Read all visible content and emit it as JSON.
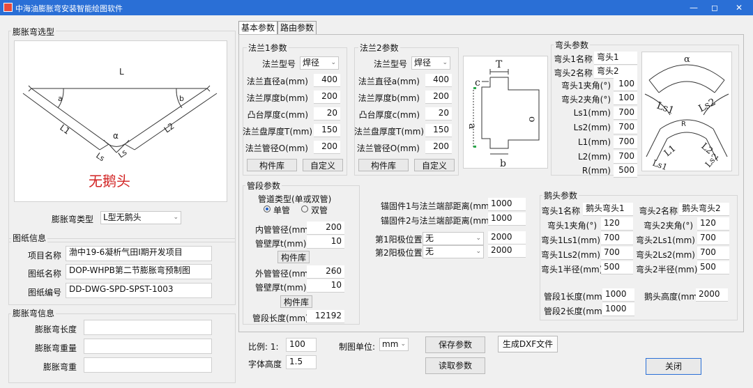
{
  "window": {
    "title": "中海油膨胀弯安装智能绘图软件"
  },
  "left": {
    "select_group": "膨胀弯选型",
    "diagram": {
      "L": "L",
      "a1": "a",
      "a2": "b",
      "L1": "L1",
      "L2": "L2",
      "alpha": "α",
      "Ls1": "Ls",
      "Ls2": "Ls",
      "caption": "无鹅头"
    },
    "type_label": "膨胀弯类型",
    "type_value": "L型无鹅头",
    "drawing_group": "图纸信息",
    "project_label": "项目名称",
    "project_value": "渤中19-6凝析气田Ⅰ期开发项目",
    "drawing_name_label": "图纸名称",
    "drawing_name_value": "DOP-WHPB第二节膨胀弯预制图",
    "drawing_no_label": "图纸编号",
    "drawing_no_value": "DD-DWG-SPD-SPST-1003",
    "info_group": "膨胀弯信息",
    "len_label": "膨胀弯长度",
    "weight_label": "膨胀弯重量",
    "weight2_label": "膨胀弯重"
  },
  "tabs": [
    "基本参数",
    "路由参数"
  ],
  "flange1": {
    "title": "法兰1参数",
    "type_label": "法兰型号",
    "type_value": "焊径",
    "rows": [
      {
        "label": "法兰直径a(mm)",
        "value": "400"
      },
      {
        "label": "法兰厚度b(mm)",
        "value": "200"
      },
      {
        "label": "凸台厚度c(mm)",
        "value": "20"
      },
      {
        "label": "法兰盘厚度T(mm)",
        "value": "150"
      },
      {
        "label": "法兰管径O(mm)",
        "value": "200"
      }
    ],
    "lib_btn": "构件库",
    "custom_btn": "自定义"
  },
  "flange2": {
    "title": "法兰2参数",
    "type_label": "法兰型号",
    "type_value": "焊径",
    "rows": [
      {
        "label": "法兰直径a(mm)",
        "value": "400"
      },
      {
        "label": "法兰厚度b(mm)",
        "value": "200"
      },
      {
        "label": "凸台厚度c(mm)",
        "value": "20"
      },
      {
        "label": "法兰盘厚度T(mm)",
        "value": "150"
      },
      {
        "label": "法兰管径O(mm)",
        "value": "200"
      }
    ],
    "lib_btn": "构件库",
    "custom_btn": "自定义"
  },
  "flange_diagram": {
    "T": "T",
    "c": "c",
    "a": "a",
    "o": "o",
    "b": "b"
  },
  "elbow": {
    "title": "弯头参数",
    "rows": [
      {
        "label": "弯头1名称",
        "value": "弯头1"
      },
      {
        "label": "弯头2名称",
        "value": "弯头2"
      },
      {
        "label": "弯头1夹角(°)",
        "value": "100"
      },
      {
        "label": "弯头2夹角(°)",
        "value": "100"
      },
      {
        "label": "Ls1(mm)",
        "value": "700"
      },
      {
        "label": "Ls2(mm)",
        "value": "700"
      },
      {
        "label": "L1(mm)",
        "value": "700"
      },
      {
        "label": "L2(mm)",
        "value": "700"
      },
      {
        "label": "R(mm)",
        "value": "500"
      }
    ],
    "diagram": {
      "alpha": "α",
      "ls1": "Ls1",
      "ls2": "Ls2",
      "R": "R",
      "l1": "L1",
      "l2": "L2",
      "ls1b": "Ls1",
      "ls2b": "Ls2"
    }
  },
  "pipe": {
    "title": "管段参数",
    "type_label": "管道类型(单或双管)",
    "single": "单管",
    "double": "双管",
    "inner_dia_label": "内管管径(mm)",
    "inner_dia": "200",
    "inner_wall_label": "管壁厚t(mm)",
    "inner_wall": "10",
    "lib_btn1": "构件库",
    "outer_dia_label": "外管管径(mm)",
    "outer_dia": "260",
    "outer_wall_label": "管壁厚t(mm)",
    "outer_wall": "10",
    "lib_btn2": "构件库",
    "length_label": "管段长度(mm)",
    "length": "12192"
  },
  "anchor": {
    "a1_label": "锚固件1与法兰端部距离(mm)",
    "a1": "1000",
    "a2_label": "锚固件2与法兰端部距离(mm)",
    "a2": "1000",
    "anode1_label": "第1阳极位置",
    "anode1_sel": "无",
    "anode1": "2000",
    "anode2_label": "第2阳极位置",
    "anode2_sel": "无",
    "anode2": "2000"
  },
  "goose": {
    "title": "鹅头参数",
    "left": [
      {
        "label": "弯头1名称",
        "value": "鹅头弯头1"
      },
      {
        "label": "弯头1夹角(°)",
        "value": "120"
      },
      {
        "label": "弯头1Ls1(mm)",
        "value": "700"
      },
      {
        "label": "弯头1Ls2(mm)",
        "value": "700"
      },
      {
        "label": "弯头1半径(mm)",
        "value": "500"
      }
    ],
    "right": [
      {
        "label": "弯头2名称",
        "value": "鹅头弯头2"
      },
      {
        "label": "弯头2夹角(°)",
        "value": "120"
      },
      {
        "label": "弯头2Ls1(mm)",
        "value": "700"
      },
      {
        "label": "弯头2Ls2(mm)",
        "value": "700"
      },
      {
        "label": "弯头2半径(mm)",
        "value": "500"
      }
    ],
    "seg1_label": "管段1长度(mm)",
    "seg1": "1000",
    "seg2_label": "管段2长度(mm)",
    "seg2": "1000",
    "height_label": "鹅头高度(mm)",
    "height": "2000"
  },
  "bottom": {
    "scale_label": "比例: 1:",
    "scale": "100",
    "font_label": "字体高度",
    "font": "1.5",
    "unit_label": "制图单位:",
    "unit": "mm",
    "save_btn": "保存参数",
    "read_btn": "读取参数",
    "dxf_btn": "生成DXF文件",
    "close_btn": "关闭"
  },
  "colors": {
    "titlebar": "#2a6fd6",
    "caption_red": "#d22222",
    "diagram_line": "#333333"
  }
}
